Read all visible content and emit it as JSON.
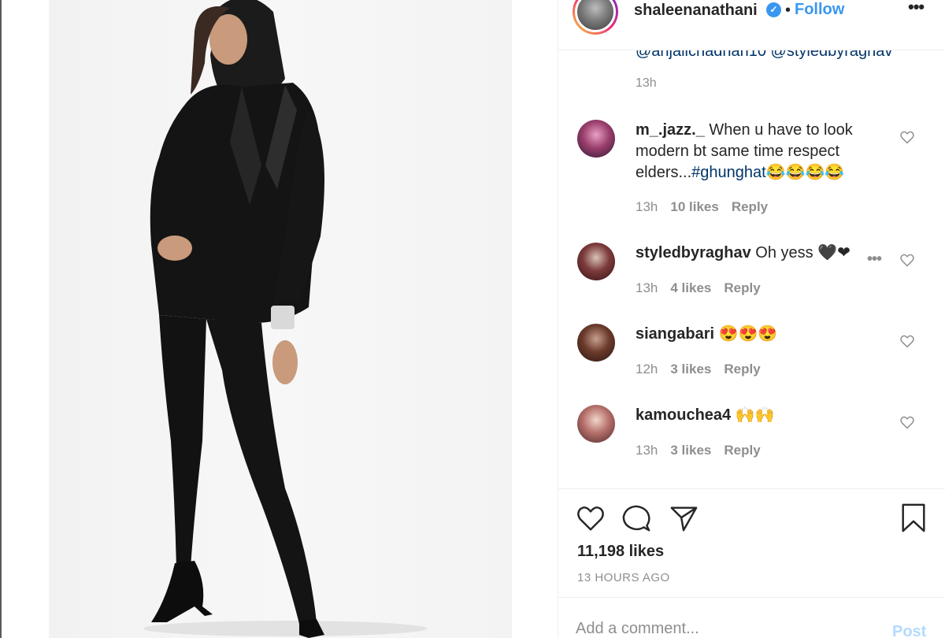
{
  "header": {
    "username": "shaleenanathani",
    "verified_glyph": "✓",
    "separator": "•",
    "follow_label": "Follow",
    "more_glyph": "•••"
  },
  "caption": {
    "tail_text": "@anjalichadhan10 @styledbyraghav",
    "time": "13h"
  },
  "comments": [
    {
      "username": "m_.jazz._",
      "text": " When u have to look modern bt same time respect elders...",
      "hashtag": "#ghunghat😂😂😂😂",
      "time": "13h",
      "likes": "10 likes",
      "reply": "Reply"
    },
    {
      "username": "styledbyraghav",
      "text": " Oh yess 🖤❤",
      "time": "13h",
      "likes": "4 likes",
      "reply": "Reply",
      "more_glyph": "•••"
    },
    {
      "username": "siangabari",
      "text": " 😍😍😍",
      "time": "12h",
      "likes": "3 likes",
      "reply": "Reply"
    },
    {
      "username": "kamouchea4",
      "text": " 🙌🙌",
      "time": "13h",
      "likes": "3 likes",
      "reply": "Reply"
    }
  ],
  "actions": {
    "icons": [
      "heart-icon",
      "comment-icon",
      "share-icon",
      "bookmark-icon"
    ],
    "likes_count": "11,198 likes",
    "post_time": "13 HOURS AGO"
  },
  "composer": {
    "placeholder": "Add a comment...",
    "post_label": "Post"
  },
  "colors": {
    "link_blue": "#3897f0",
    "hashtag_navy": "#003569",
    "muted_gray": "#8e8e8e",
    "post_disabled": "#b3dbff"
  }
}
